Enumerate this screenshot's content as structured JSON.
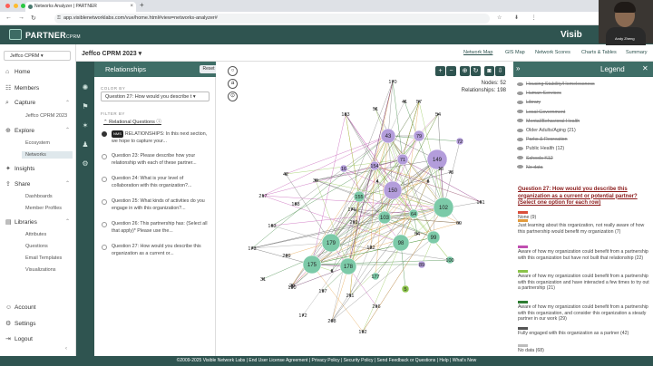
{
  "browser": {
    "tab_title": "Networks Analyzer | PARTNER",
    "url": "app.visiblenetworklabs.com/vue/home.html#view=networks-analyzer#"
  },
  "app": {
    "logo_main": "PARTNER",
    "logo_sub": "CPRM",
    "brand_right": "Visib",
    "presenter_name": "Andy Zheng"
  },
  "leftnav": {
    "org": "Jeffco CPRM",
    "items": [
      {
        "label": "Home",
        "icon": "home-icon"
      },
      {
        "label": "Members",
        "icon": "members-icon"
      },
      {
        "label": "Capture",
        "icon": "capture-icon"
      },
      {
        "label": "Explore",
        "icon": "explore-icon"
      },
      {
        "label": "Insights",
        "icon": "insights-icon"
      },
      {
        "label": "Share",
        "icon": "share-icon"
      },
      {
        "label": "Libraries",
        "icon": "libraries-icon"
      },
      {
        "label": "Account",
        "icon": "account-icon"
      },
      {
        "label": "Settings",
        "icon": "settings-icon"
      },
      {
        "label": "Logout",
        "icon": "logout-icon"
      }
    ],
    "capture_sub": [
      "Jeffco CPRM 2023"
    ],
    "explore_sub": [
      "Ecosystem",
      "Networks"
    ],
    "share_sub": [
      "Dashboards",
      "Member Profiles"
    ],
    "libraries_sub": [
      "Attributes",
      "Questions",
      "Email Templates",
      "Visualizations"
    ]
  },
  "subheader": {
    "title": "Jeffco CPRM 2023",
    "tabs": [
      "Network Map",
      "GIS Map",
      "Network Scores",
      "Charts & Tables",
      "Summary"
    ]
  },
  "relationships": {
    "title": "Relationships",
    "reset": "Reset",
    "color_by_label": "COLOR BY",
    "color_by_value": "Question 27: How would you describe t",
    "filter_by_label": "FILTER BY",
    "relational_questions": "Relational Questions",
    "nms_badge": "NMS",
    "questions": [
      "RELATIONSHIPS: In this next section, we hope to capture your...",
      "Question 23: Please describe how your relationship with each of these partner...",
      "Question 24: What is your level of collaboration with this organization?...",
      "Question 25: What kinds of activities do you engage in with this organization?...",
      "Question 26: This partnership has: (Select all that apply)* Please use the...",
      "Question 27: How would you describe this organization as a current or..."
    ]
  },
  "network": {
    "nodes_label": "Nodes: 52",
    "relationships_label": "Relationships: 198",
    "node_labels": [
      "170",
      "183",
      "51",
      "41",
      "57",
      "54",
      "72",
      "43",
      "79",
      "149",
      "42",
      "16",
      "71",
      "154",
      "13",
      "4",
      "6",
      "39",
      "217",
      "188",
      "155",
      "150",
      "176",
      "103",
      "64",
      "102",
      "161",
      "219",
      "54",
      "69",
      "173",
      "163",
      "179",
      "122",
      "98",
      "99",
      "6",
      "175",
      "178",
      "100",
      "89",
      "209",
      "28",
      "197",
      "211",
      "177",
      "5",
      "190",
      "31",
      "172",
      "208",
      "216",
      "192",
      "73"
    ]
  },
  "legend": {
    "title": "Legend",
    "items": [
      {
        "label": "Housing Stability/Homelessness",
        "color": "#999999",
        "struck": true
      },
      {
        "label": "Human Services",
        "color": "#999999",
        "struck": true
      },
      {
        "label": "Library",
        "color": "#999999",
        "struck": true
      },
      {
        "label": "Local Government",
        "color": "#999999",
        "struck": true
      },
      {
        "label": "Mental/Behavioral Health",
        "color": "#999999",
        "struck": true
      },
      {
        "label": "Older Adults/Aging (21)",
        "color": "#9a9a9a",
        "struck": false
      },
      {
        "label": "Parks & Recreation",
        "color": "#999999",
        "struck": true
      },
      {
        "label": "Public Health (12)",
        "color": "#9a9a9a",
        "struck": false
      },
      {
        "label": "Schools K12",
        "color": "#999999",
        "struck": true
      },
      {
        "label": "No data",
        "color": "#999999",
        "struck": true
      }
    ],
    "question": "Question 27: How would you describe this organization as a current or potential partner? (Select one option for each row)",
    "responses": [
      {
        "label": "None (9)",
        "color": "#d94f3b"
      },
      {
        "label": "Just learning about this organization, not really aware of how this partnership would benefit my organization (7)",
        "color": "#e39b3c"
      },
      {
        "label": "Aware of how my organization could benefit from a partnership with this organization but have not built that relationship (22)",
        "color": "#c04fb0"
      },
      {
        "label": "Aware of how my organization could benefit from a partnership with this organization and have interacted a few times to try out a partnership (21)",
        "color": "#8bc34a"
      },
      {
        "label": "Aware of how my organization could benefit from a partnership with this organization, and consider this organization a steady partner in our work (29)",
        "color": "#2e7d32"
      },
      {
        "label": "Fully engaged with this organization as a partner (42)",
        "color": "#555555"
      },
      {
        "label": "No data (68)",
        "color": "#bdbdbd"
      }
    ]
  },
  "footer": {
    "text": "©2009-2025 Visible Network Labs  |  End User License Agreement  |  Privacy Policy  |  Security Policy  |  Send Feedback or Questions  |  Help  |  What's New"
  }
}
